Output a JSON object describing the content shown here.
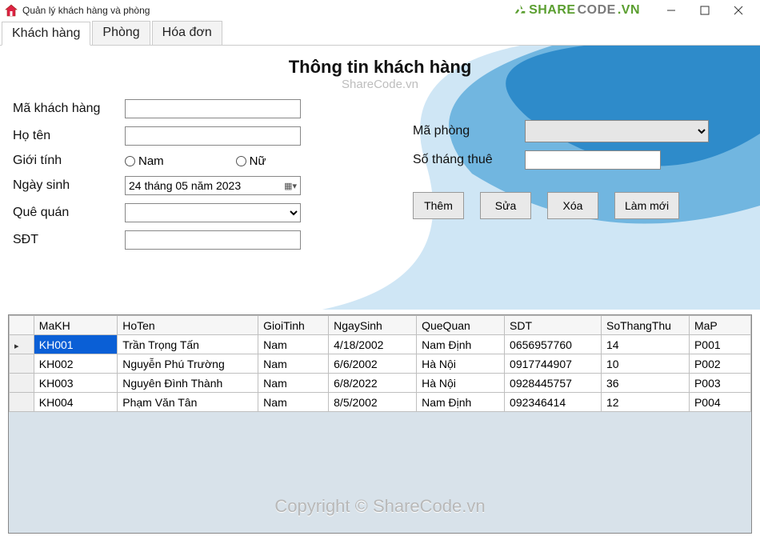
{
  "window": {
    "title": "Quản lý khách hàng và phòng"
  },
  "brand": {
    "text_share": "SHARE",
    "text_code": "CODE",
    "text_tld": ".VN"
  },
  "tabs": [
    {
      "label": "Khách hàng",
      "active": true
    },
    {
      "label": "Phòng",
      "active": false
    },
    {
      "label": "Hóa đơn",
      "active": false
    }
  ],
  "section_title": "Thông tin khách hàng",
  "watermark_small": "ShareCode.vn",
  "watermark_big": "Copyright © ShareCode.vn",
  "form": {
    "ma_khach_hang_label": "Mã khách hàng",
    "ma_khach_hang_value": "",
    "ho_ten_label": "Họ tên",
    "ho_ten_value": "",
    "gioi_tinh_label": "Giới tính",
    "gioi_tinh_nam": "Nam",
    "gioi_tinh_nu": "Nữ",
    "ngay_sinh_label": "Ngày sinh",
    "ngay_sinh_value": "24 tháng 05 năm 2023",
    "que_quan_label": "Quê quán",
    "que_quan_value": "",
    "sdt_label": "SĐT",
    "sdt_value": "",
    "ma_phong_label": "Mã phòng",
    "ma_phong_value": "",
    "so_thang_thue_label": "Số tháng thuê",
    "so_thang_thue_value": ""
  },
  "buttons": {
    "them": "Thêm",
    "sua": "Sửa",
    "xoa": "Xóa",
    "lam_moi": "Làm mới"
  },
  "grid": {
    "headers": {
      "makh": "MaKH",
      "hoten": "HoTen",
      "gioitinh": "GioiTinh",
      "ngaysinh": "NgaySinh",
      "quequan": "QueQuan",
      "sdt": "SDT",
      "sothangthue": "SoThangThu",
      "map": "MaP"
    },
    "rows": [
      {
        "makh": "KH001",
        "hoten": "Trần Trọng Tấn",
        "gioitinh": "Nam",
        "ngaysinh": "4/18/2002",
        "quequan": "Nam Định",
        "sdt": "0656957760",
        "sothangthue": "14",
        "map": "P001",
        "selected": true
      },
      {
        "makh": "KH002",
        "hoten": "Nguyễn Phú Trường",
        "gioitinh": "Nam",
        "ngaysinh": "6/6/2002",
        "quequan": "Hà Nội",
        "sdt": "0917744907",
        "sothangthue": "10",
        "map": "P002",
        "selected": false
      },
      {
        "makh": "KH003",
        "hoten": "Nguyên Đình Thành",
        "gioitinh": "Nam",
        "ngaysinh": "6/8/2022",
        "quequan": "Hà Nội",
        "sdt": "0928445757",
        "sothangthue": "36",
        "map": "P003",
        "selected": false
      },
      {
        "makh": "KH004",
        "hoten": "Phạm Văn Tân",
        "gioitinh": "Nam",
        "ngaysinh": "8/5/2002",
        "quequan": "Nam Định",
        "sdt": "092346414",
        "sothangthue": "12",
        "map": "P004",
        "selected": false
      }
    ]
  }
}
